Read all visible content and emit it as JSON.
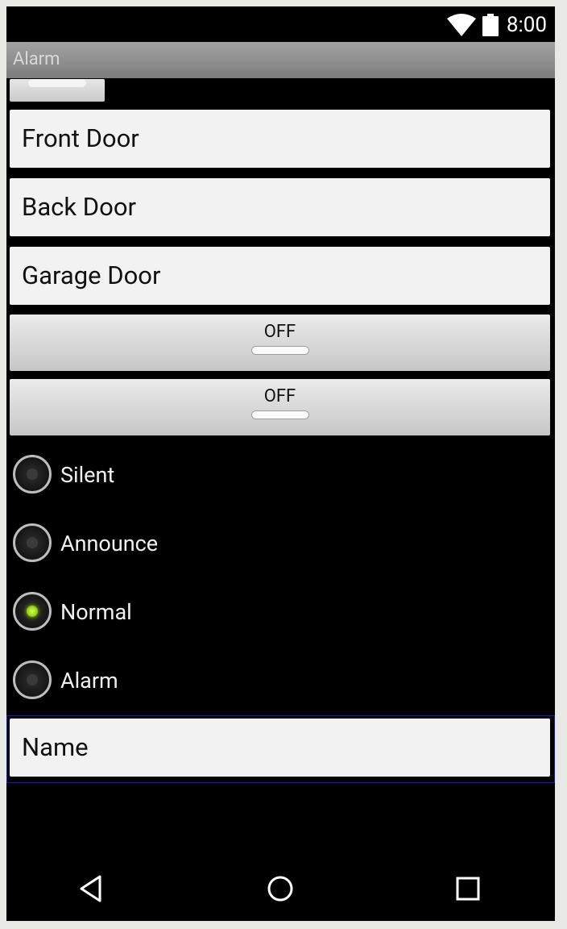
{
  "status_bar": {
    "time": "8:00",
    "icons": [
      "wifi-icon",
      "battery-icon"
    ]
  },
  "app": {
    "title": "Alarm"
  },
  "doors": [
    {
      "label": "Front Door"
    },
    {
      "label": "Back Door"
    },
    {
      "label": "Garage Door"
    }
  ],
  "toggles": [
    {
      "label": "OFF",
      "state": "off"
    },
    {
      "label": "OFF",
      "state": "off"
    }
  ],
  "modes": [
    {
      "label": "Silent",
      "checked": false
    },
    {
      "label": "Announce",
      "checked": false
    },
    {
      "label": "Normal",
      "checked": true
    },
    {
      "label": "Alarm",
      "checked": false
    }
  ],
  "name_field": {
    "value": "Name"
  },
  "nav": {
    "buttons": [
      "back-icon",
      "home-icon",
      "recents-icon"
    ]
  },
  "colors": {
    "radio_checked": "#88cc00",
    "title_bar": "#8e8e8e",
    "focus_border": "#1818c8"
  }
}
